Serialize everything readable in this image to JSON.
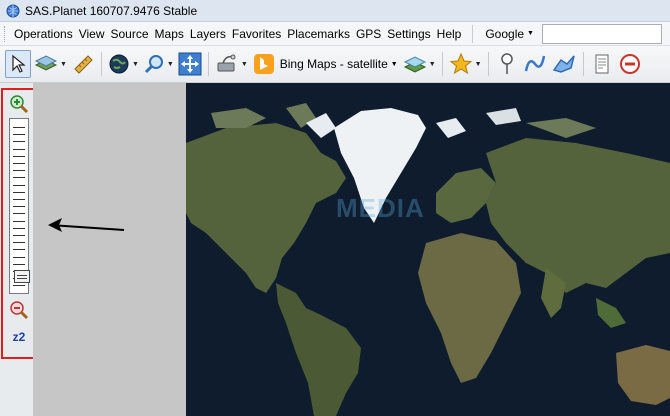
{
  "window": {
    "title": "SAS.Planet 160707.9476 Stable",
    "icon": "globe-app-icon"
  },
  "menu": {
    "items": [
      "Operations",
      "View",
      "Source",
      "Maps",
      "Layers",
      "Favorites",
      "Placemarks",
      "GPS",
      "Settings",
      "Help"
    ],
    "search_provider": "Google",
    "search_value": ""
  },
  "toolbar": {
    "map_source_label": "Bing Maps - satellite",
    "icons": [
      "cursor-icon",
      "layers-icon",
      "ruler-icon",
      "globe-icon",
      "magnifier-icon",
      "fullscreen-icon",
      "satellite-dish-icon",
      "bing-logo-icon",
      "map-layers-icon",
      "star-icon",
      "pin-icon",
      "path-icon",
      "polygon-icon",
      "notes-icon",
      "stop-icon"
    ]
  },
  "zoom": {
    "level_label": "z2",
    "level_fraction": 0.05
  },
  "map": {
    "watermark": "MEDIA"
  },
  "colors": {
    "highlight_border": "#e01e1e",
    "zoom_label": "#1a3fa8",
    "ocean": "#0c1829",
    "land": "#4f5d3a"
  }
}
